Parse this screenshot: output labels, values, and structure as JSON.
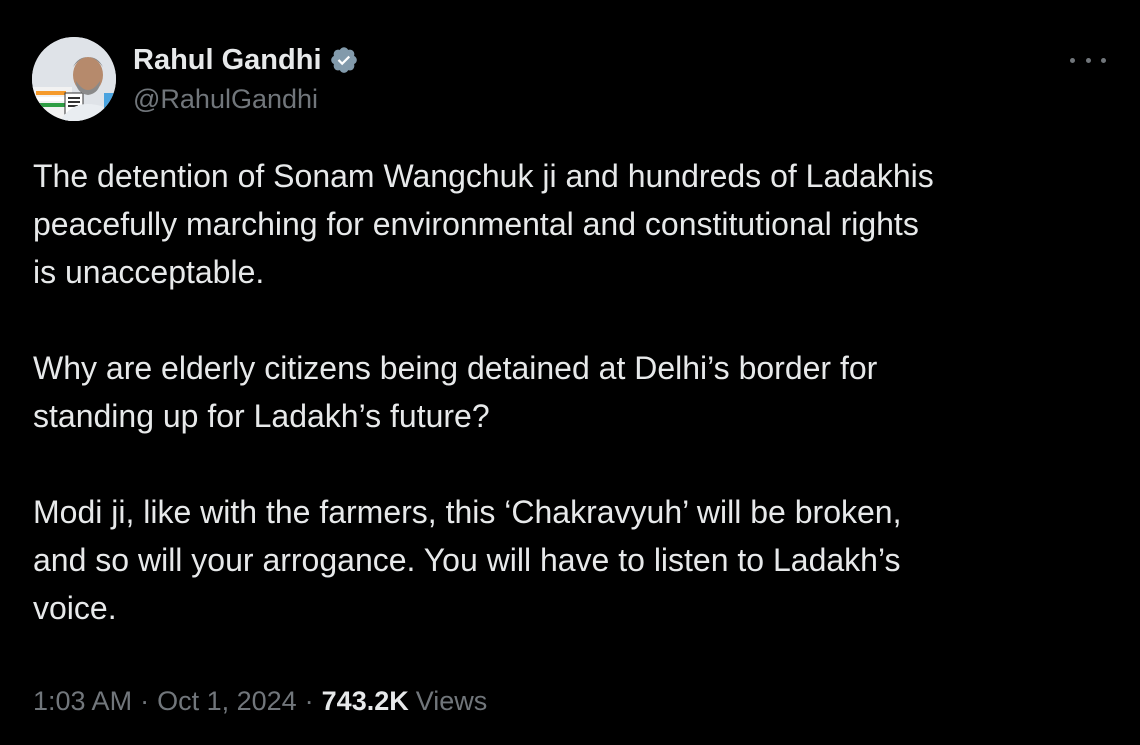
{
  "author": {
    "display_name": "Rahul Gandhi",
    "handle": "@RahulGandhi",
    "verified": true,
    "verified_color": "#829aab"
  },
  "tweet": {
    "paragraphs": [
      "The detention of Sonam Wangchuk ji and hundreds of Ladakhis\npeacefully marching for environmental and constitutional rights\nis unacceptable.",
      "Why are elderly citizens being detained at Delhi’s border for\nstanding up for Ladakh’s future?",
      "Modi ji, like with the farmers, this ‘Chakravyuh’ will be broken,\nand so will your arrogance. You will have to listen to Ladakh’s\nvoice."
    ]
  },
  "meta": {
    "time": "1:03 AM",
    "separator": "·",
    "date": "Oct 1, 2024",
    "views_count": "743.2K",
    "views_label": "Views"
  },
  "icons": {
    "verified": "verified-badge-icon",
    "more": "more-options-icon"
  },
  "colors": {
    "background": "#000000",
    "primary_text": "#e7e9ea",
    "secondary_text": "#71767b"
  }
}
